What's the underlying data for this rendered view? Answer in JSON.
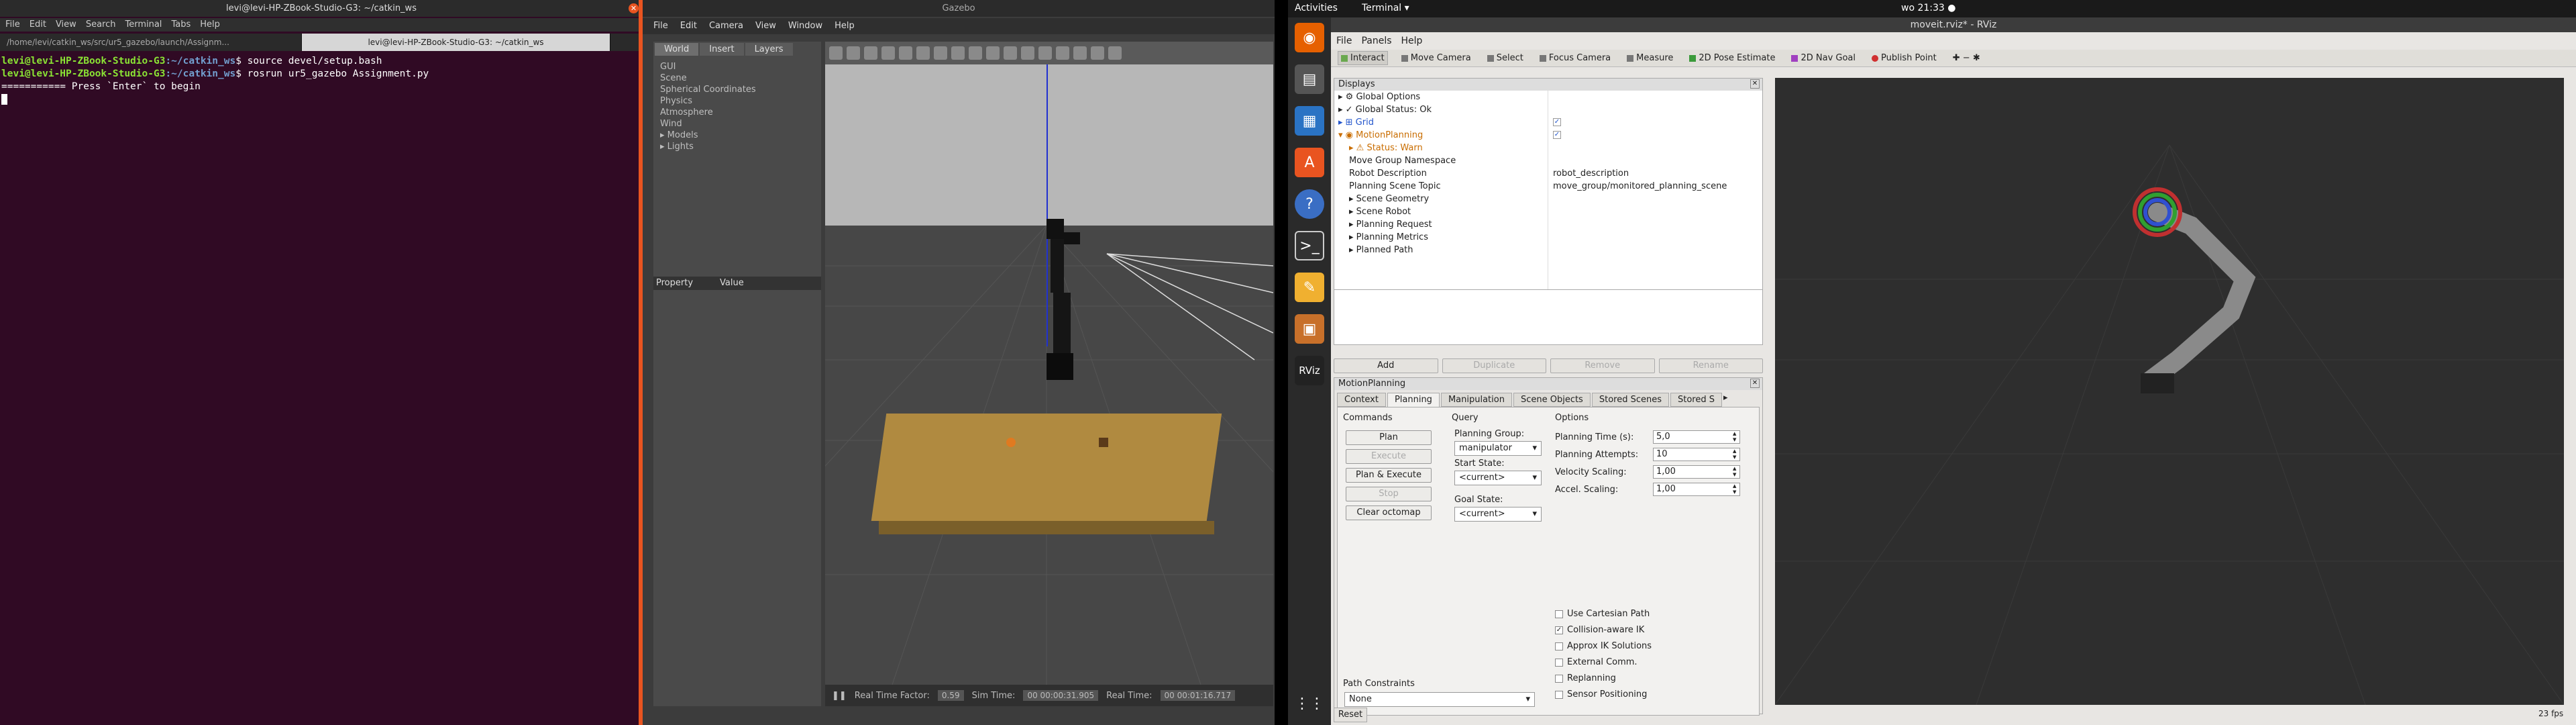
{
  "terminal": {
    "title": "levi@levi-HP-ZBook-Studio-G3: ~/catkin_ws",
    "menu": [
      "File",
      "Edit",
      "View",
      "Search",
      "Terminal",
      "Tabs",
      "Help"
    ],
    "tabs": [
      "/home/levi/catkin_ws/src/ur5_gazebo/launch/Assignm...",
      "levi@levi-HP-ZBook-Studio-G3: ~/catkin_ws"
    ],
    "lines": [
      {
        "user": "levi@levi-HP-ZBook-Studio-G3",
        "path": ":~/catkin_ws",
        "cmd": "$ source devel/setup.bash"
      },
      {
        "user": "levi@levi-HP-ZBook-Studio-G3",
        "path": ":~/catkin_ws",
        "cmd": "$ rosrun ur5_gazebo Assignment.py"
      }
    ],
    "output": "=========== Press `Enter` to begin"
  },
  "gazebo": {
    "title": "Gazebo",
    "menu": [
      "File",
      "Edit",
      "Camera",
      "View",
      "Window",
      "Help"
    ],
    "tabs": [
      "World",
      "Insert",
      "Layers"
    ],
    "tree": [
      "GUI",
      "Scene",
      "Spherical Coordinates",
      "Physics",
      "Atmosphere",
      "Wind",
      "▸ Models",
      "▸ Lights"
    ],
    "prop_headers": [
      "Property",
      "Value"
    ],
    "status": {
      "rtf_label": "Real Time Factor:",
      "rtf": "0.59",
      "sim_label": "Sim Time:",
      "sim": "00 00:00:31.905",
      "real_label": "Real Time:",
      "real": "00 00:01:16.717"
    }
  },
  "topbar": {
    "activities": "Activities",
    "app": "Terminal ▾",
    "clock": "wo 21:33 ●"
  },
  "rviz": {
    "title": "moveit.rviz* - RViz",
    "menu": [
      "File",
      "Panels",
      "Help"
    ],
    "tools": [
      "Interact",
      "Move Camera",
      "Select",
      "Focus Camera",
      "Measure",
      "2D Pose Estimate",
      "2D Nav Goal",
      "Publish Point"
    ],
    "displays_title": "Displays",
    "display_rows": [
      {
        "indent": 0,
        "label": "▸ ⚙ Global Options",
        "value": "",
        "check": ""
      },
      {
        "indent": 0,
        "label": "▸ ✓ Global Status: Ok",
        "value": "",
        "check": ""
      },
      {
        "indent": 0,
        "label": "▸ ⊞ Grid",
        "value": "",
        "check": "✓",
        "color": "#2255cc"
      },
      {
        "indent": 0,
        "label": "▾ ◉ MotionPlanning",
        "value": "",
        "check": "✓",
        "color": "#c96d00"
      },
      {
        "indent": 1,
        "label": "▸ ⚠ Status: Warn",
        "value": "",
        "check": "",
        "color": "#c96d00"
      },
      {
        "indent": 1,
        "label": "Move Group Namespace",
        "value": "",
        "check": ""
      },
      {
        "indent": 1,
        "label": "Robot Description",
        "value": "robot_description",
        "check": ""
      },
      {
        "indent": 1,
        "label": "Planning Scene Topic",
        "value": "move_group/monitored_planning_scene",
        "check": ""
      },
      {
        "indent": 1,
        "label": "▸ Scene Geometry",
        "value": "",
        "check": ""
      },
      {
        "indent": 1,
        "label": "▸ Scene Robot",
        "value": "",
        "check": ""
      },
      {
        "indent": 1,
        "label": "▸ Planning Request",
        "value": "",
        "check": ""
      },
      {
        "indent": 1,
        "label": "▸ Planning Metrics",
        "value": "",
        "check": ""
      },
      {
        "indent": 1,
        "label": "▸ Planned Path",
        "value": "",
        "check": ""
      }
    ],
    "display_buttons": [
      "Add",
      "Duplicate",
      "Remove",
      "Rename"
    ],
    "mp_title": "MotionPlanning",
    "mp_tabs": [
      "Context",
      "Planning",
      "Manipulation",
      "Scene Objects",
      "Stored Scenes",
      "Stored S"
    ],
    "commands_label": "Commands",
    "query_label": "Query",
    "options_label": "Options",
    "buttons": {
      "plan": "Plan",
      "execute": "Execute",
      "plan_execute": "Plan & Execute",
      "stop": "Stop",
      "clear": "Clear octomap"
    },
    "planning_group_label": "Planning Group:",
    "planning_group": "manipulator",
    "start_state_label": "Start State:",
    "start_state": "<current>",
    "goal_state_label": "Goal State:",
    "goal_state": "<current>",
    "options": [
      {
        "label": "Planning Time (s):",
        "value": "5,0"
      },
      {
        "label": "Planning Attempts:",
        "value": "10"
      },
      {
        "label": "Velocity Scaling:",
        "value": "1,00"
      },
      {
        "label": "Accel. Scaling:",
        "value": "1,00"
      }
    ],
    "checks": [
      {
        "label": "Use Cartesian Path",
        "checked": ""
      },
      {
        "label": "Collision-aware IK",
        "checked": "✓"
      },
      {
        "label": "Approx IK Solutions",
        "checked": ""
      },
      {
        "label": "External Comm.",
        "checked": ""
      },
      {
        "label": "Replanning",
        "checked": ""
      },
      {
        "label": "Sensor Positioning",
        "checked": ""
      }
    ],
    "path_constraints_label": "Path Constraints",
    "path_constraints": "None",
    "reset": "Reset",
    "fps": "23 fps"
  }
}
